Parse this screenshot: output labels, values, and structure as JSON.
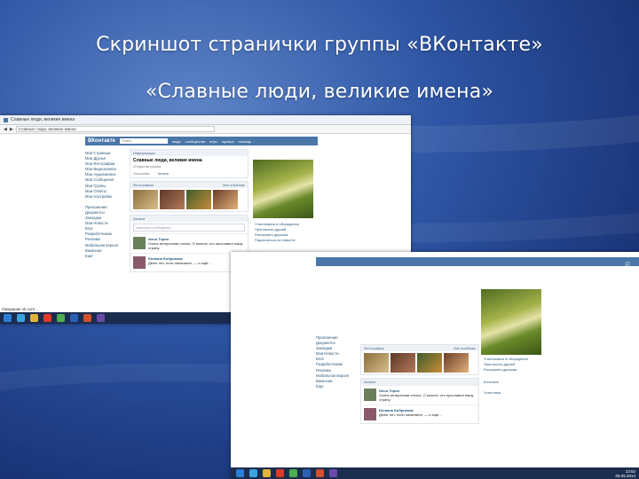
{
  "slide": {
    "title_line1": "Скриншот странички группы «ВКонтакте»",
    "title_line2": "«Славные люди, великие имена»"
  },
  "browser": {
    "tab_label": "Славные люди, великие имена",
    "address": "Славные люди, великие имена",
    "status_text": "Ожидание vk.com..."
  },
  "vk": {
    "logo": "ВКонтакте",
    "search_placeholder": "Поиск",
    "menu": [
      "люди",
      "сообщества",
      "игры",
      "музыка",
      "помощь"
    ],
    "left_nav": [
      "Моя Страница",
      "Мои Друзья",
      "Мои Фотографии",
      "Мои Видеозаписи",
      "Мои Аудиозаписи",
      "Мои Сообщения",
      "Мои Группы",
      "Мои Ответы",
      "Мои Настройки",
      "Приложения",
      "Документы",
      "Закладки",
      "Мои Новости",
      "Блог",
      "Разработчикам",
      "Реклама",
      "Мобильная версия",
      "Вакансии",
      "Ещё"
    ],
    "group": {
      "header": "Информация",
      "name": "Славные люди, великие имена",
      "status": "Открытая группа",
      "info_label": "Описание:",
      "info_value": "Читать",
      "photos_header": "Фотографии",
      "photos_link": "Все альбомы",
      "wall_header": "Записи",
      "wall_input": "Написать сообщение...",
      "post1_author": "Илья Терин",
      "post1_text": "Очень интересная статья. О многих, кто прославил нашу страну.",
      "post2_author": "Юлиана Бобрикова",
      "post2_text": "Денег нет, если начинаете, — и ещё..."
    },
    "right": {
      "links": [
        "Участвовать в обсуждении",
        "Пригласить друзей",
        "Рассказать друзьям",
        "Подписаться на новости"
      ],
      "members_header": "Участники",
      "contacts_header": "Контакты"
    }
  },
  "taskbar": {
    "time": "13:52",
    "date": "09.05.2014"
  }
}
